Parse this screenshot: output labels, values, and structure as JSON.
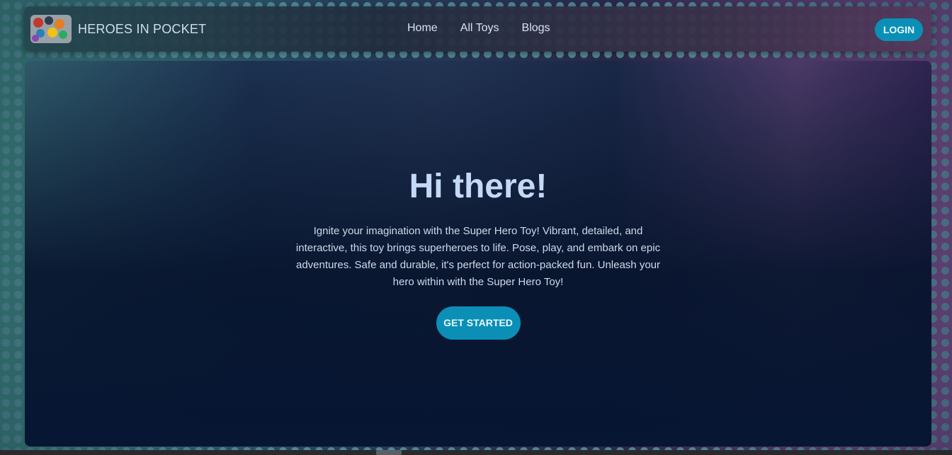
{
  "navbar": {
    "brand": "HEROES IN POCKET",
    "logo_icon": "toy-collection-logo",
    "menu": [
      {
        "label": "Home"
      },
      {
        "label": "All Toys"
      },
      {
        "label": "Blogs"
      }
    ],
    "login_label": "LOGIN"
  },
  "hero": {
    "title": "Hi there!",
    "description": "Ignite your imagination with the Super Hero Toy! Vibrant, detailed, and interactive, this toy brings superheroes to life. Pose, play, and embark on epic adventures. Safe and durable, it's perfect for action-packed fun. Unleash your hero within with the Super Hero Toy!",
    "cta_label": "GET STARTED"
  },
  "colors": {
    "accent": "#0b8fb6",
    "background": "#071226",
    "title": "#c4d8f7"
  }
}
